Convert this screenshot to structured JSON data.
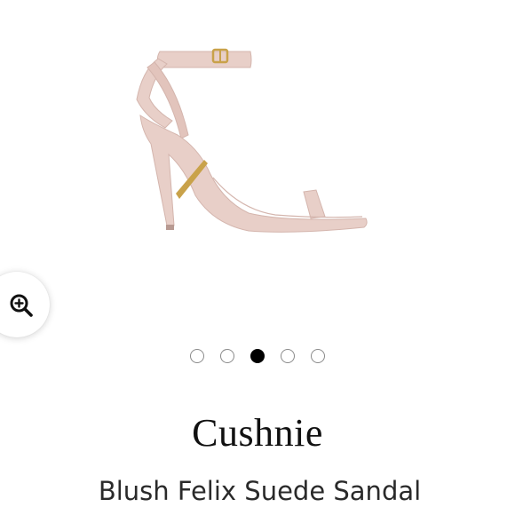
{
  "product": {
    "image_alt": "Blush suede ankle-strap stiletto sandal",
    "brand": "Cushnie",
    "name": "Blush Felix Suede Sandal"
  },
  "gallery": {
    "image_count": 5,
    "active_index": 3
  },
  "zoom": {
    "icon": "zoom-in-icon"
  },
  "colors": {
    "shoe": "#e8cfc8",
    "shoe_shadow": "#d4b5ad",
    "heel_accent": "#c9a24a",
    "dot_active": "#000000",
    "dot_inactive_border": "#8a8a8a"
  }
}
